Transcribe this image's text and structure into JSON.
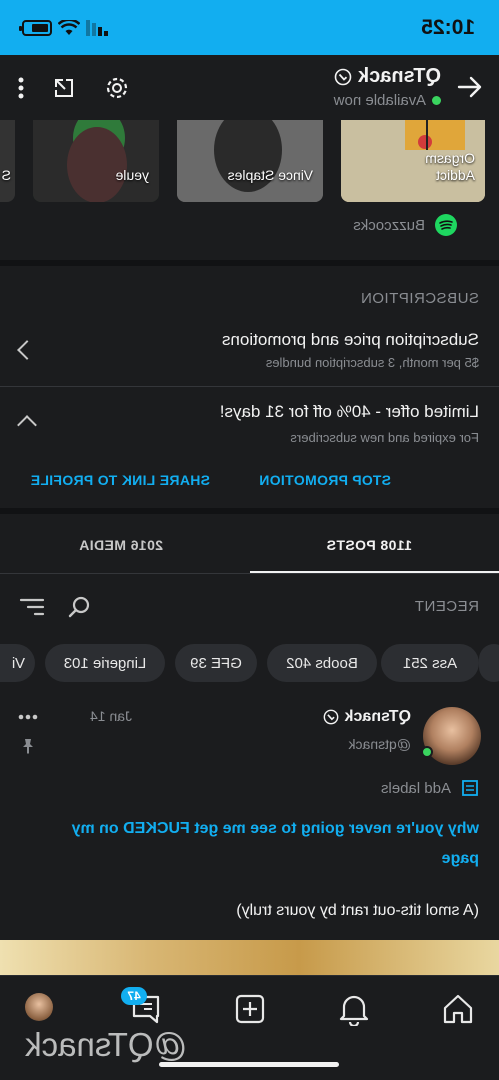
{
  "status_bar": {
    "time": "10:25"
  },
  "header": {
    "name": "QTsnack",
    "status": "Available now"
  },
  "music": {
    "cards": [
      {
        "label": "Orgasm Addict"
      },
      {
        "label": "Vince Staples"
      },
      {
        "label": "yeule"
      },
      {
        "label": "S"
      }
    ],
    "source_artist": "Buzzcocks",
    "source_icon": "spotify-icon"
  },
  "subscription": {
    "section_title": "SUBSCRIPTION",
    "price_title": "Subscription price and promotions",
    "price_subtitle": "$5 per month, 3 subscription bundles",
    "offer_title": "Limited offer - 40% off for 31 days!",
    "offer_subtitle": "For expired and new subscribers",
    "stop_promotion": "STOP PROMOTION",
    "share_link": "SHARE LINK TO PROFILE"
  },
  "tabs": [
    {
      "label": "1108 POSTS",
      "active": true
    },
    {
      "label": "2016 MEDIA",
      "active": false
    }
  ],
  "filter": {
    "label": "RECENT"
  },
  "chips": [
    "Ass 251",
    "Boobs 402",
    "GFE 39",
    "Lingerie 103",
    "Vi"
  ],
  "post": {
    "author": "QTsnack",
    "handle": "@qtsnack",
    "date": "Jan 14",
    "add_labels": "Add labels",
    "title": "why you're never going to see me get FUCKED on my page",
    "body": "(A smol tits-out rant by yours truly)"
  },
  "nav": {
    "messages_badge": "47"
  },
  "watermark": "@QTsnack",
  "colors": {
    "accent": "#12aef0",
    "online": "#3ad45f",
    "background": "#1b1c1e",
    "spotify": "#1ed760"
  }
}
